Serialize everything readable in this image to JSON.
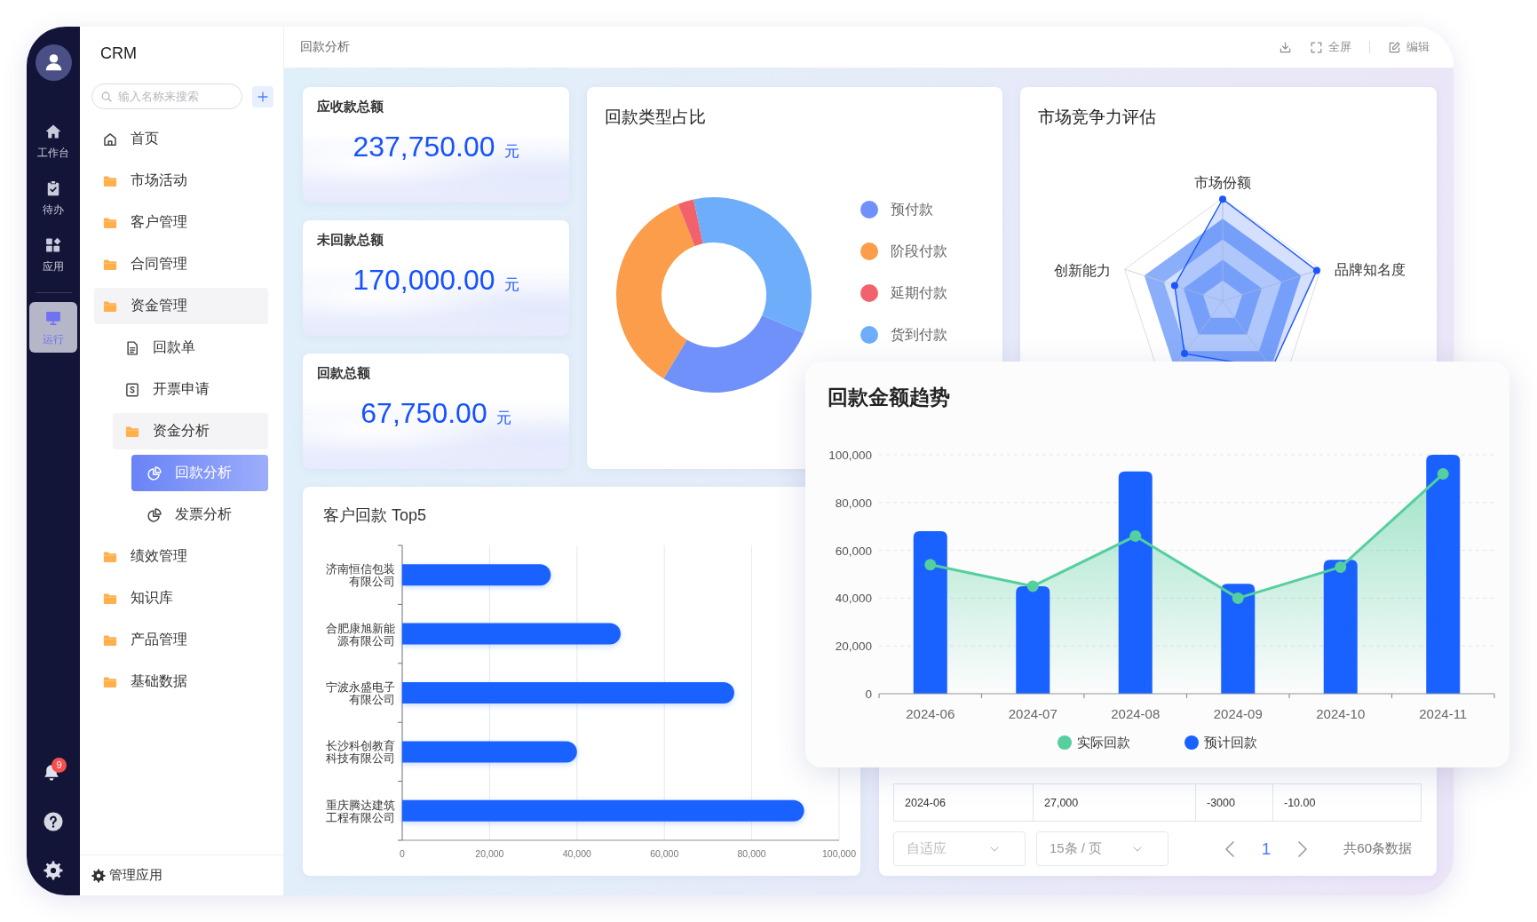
{
  "nav_rail": {
    "items": [
      {
        "label": "工作台",
        "kind": "home",
        "selected": false
      },
      {
        "label": "待办",
        "kind": "tasks",
        "selected": false
      },
      {
        "label": "应用",
        "kind": "apps",
        "selected": false
      },
      {
        "label": "运行",
        "kind": "monitor",
        "selected": true
      }
    ],
    "notifications": {
      "badge": "9"
    }
  },
  "sidebar": {
    "title": "CRM",
    "search": {
      "placeholder": "输入名称来搜索"
    },
    "menu": [
      {
        "label": "首页",
        "kind": "home",
        "selected": false
      },
      {
        "label": "市场活动",
        "kind": "folder",
        "selected": false
      },
      {
        "label": "客户管理",
        "kind": "folder",
        "selected": false
      },
      {
        "label": "合同管理",
        "kind": "folder",
        "selected": false
      },
      {
        "label": "资金管理",
        "kind": "folder",
        "selected": false,
        "children": [
          {
            "label": "回款单",
            "kind": "document",
            "selected": false
          },
          {
            "label": "开票申请",
            "kind": "invoice",
            "selected": false
          },
          {
            "label": "资金分析",
            "kind": "folder",
            "selected": false,
            "children": [
              {
                "label": "回款分析",
                "kind": "report",
                "selected": true
              },
              {
                "label": "发票分析",
                "kind": "report",
                "selected": false
              }
            ]
          }
        ]
      },
      {
        "label": "绩效管理",
        "kind": "folder",
        "selected": false
      },
      {
        "label": "知识库",
        "kind": "folder",
        "selected": false
      },
      {
        "label": "产品管理",
        "kind": "folder",
        "selected": false
      },
      {
        "label": "基础数据",
        "kind": "folder",
        "selected": false
      }
    ],
    "footer": {
      "label": "管理应用"
    }
  },
  "top_bar": {
    "breadcrumb": "回款分析",
    "actions": [
      {
        "kind": "download"
      },
      {
        "kind": "fullscreen",
        "label": "全屏"
      },
      {
        "kind": "edit",
        "label": "编辑"
      }
    ]
  },
  "stat_cards": [
    {
      "label": "应收款总额",
      "value": "237,750.00",
      "unit": "元"
    },
    {
      "label": "未回款总额",
      "value": "170,000.00",
      "unit": "元"
    },
    {
      "label": "回款总额",
      "value": "67,750.00",
      "unit": "元"
    }
  ],
  "payment_type_share": {
    "title": "回款类型占比",
    "legend": [
      {
        "label": "预付款",
        "color": "#7090fa"
      },
      {
        "label": "阶段付款",
        "color": "#fb9d4a"
      },
      {
        "label": "延期付款",
        "color": "#f2626c"
      },
      {
        "label": "货到付款",
        "color": "#6eadfa"
      }
    ]
  },
  "competitiveness": {
    "title": "市场竞争力评估",
    "axes": [
      "市场份额",
      "品牌知名度",
      "创新能力"
    ]
  },
  "customer_top5": {
    "title": "客户回款 Top5",
    "chart_data": {
      "type": "bar",
      "orientation": "horizontal",
      "grid": true,
      "categories": [
        "济南恒信包装有限公司",
        "合肥康旭新能源有限公司",
        "宁波永盛电子有限公司",
        "长沙科创教育科技有限公司",
        "重庆腾达建筑工程有限公司"
      ],
      "values": [
        34000,
        50000,
        76000,
        40000,
        92000
      ],
      "xlim": [
        0,
        100000
      ],
      "xticks": [
        0,
        {
          "value": 20000,
          "label": "20,000"
        },
        {
          "value": 40000,
          "label": "40,000"
        },
        {
          "value": 60000,
          "label": "60,000"
        },
        {
          "value": 80000,
          "label": "80,000"
        },
        {
          "value": 100000,
          "label": "100,000"
        }
      ]
    }
  },
  "payment_table": {
    "rows": [
      [
        "2024-06",
        "27,000",
        "-3000",
        "-10.00"
      ]
    ],
    "pagination": {
      "fit": {
        "placeholder": "自适应"
      },
      "page_size": "15条 / 页",
      "pages": [
        {
          "label": "1",
          "selected": true
        }
      ],
      "total": "共60条数据"
    }
  },
  "trend_card": {
    "title": "回款金额趋势",
    "chart_data": {
      "type": "bar",
      "grid": true,
      "categories": [
        "2024-06",
        "2024-07",
        "2024-08",
        "2024-09",
        "2024-10",
        "2024-11"
      ],
      "series": [
        {
          "name": "实际回款",
          "type": "area",
          "marker": true,
          "color": "#55cf9d",
          "values": [
            54000,
            45000,
            66000,
            40000,
            53000,
            92000
          ]
        },
        {
          "name": "预计回款",
          "color": "#1a62ff",
          "values": [
            68000,
            45000,
            93000,
            46000,
            56000,
            100000
          ]
        }
      ],
      "ylim": [
        0,
        100000
      ],
      "yticks": [
        0,
        {
          "value": 20000,
          "label": "20,000"
        },
        {
          "value": 40000,
          "label": "40,000"
        },
        {
          "value": 60000,
          "label": "60,000"
        },
        {
          "value": 80000,
          "label": "80,000"
        },
        {
          "value": 100000,
          "label": "100,000"
        }
      ]
    }
  }
}
